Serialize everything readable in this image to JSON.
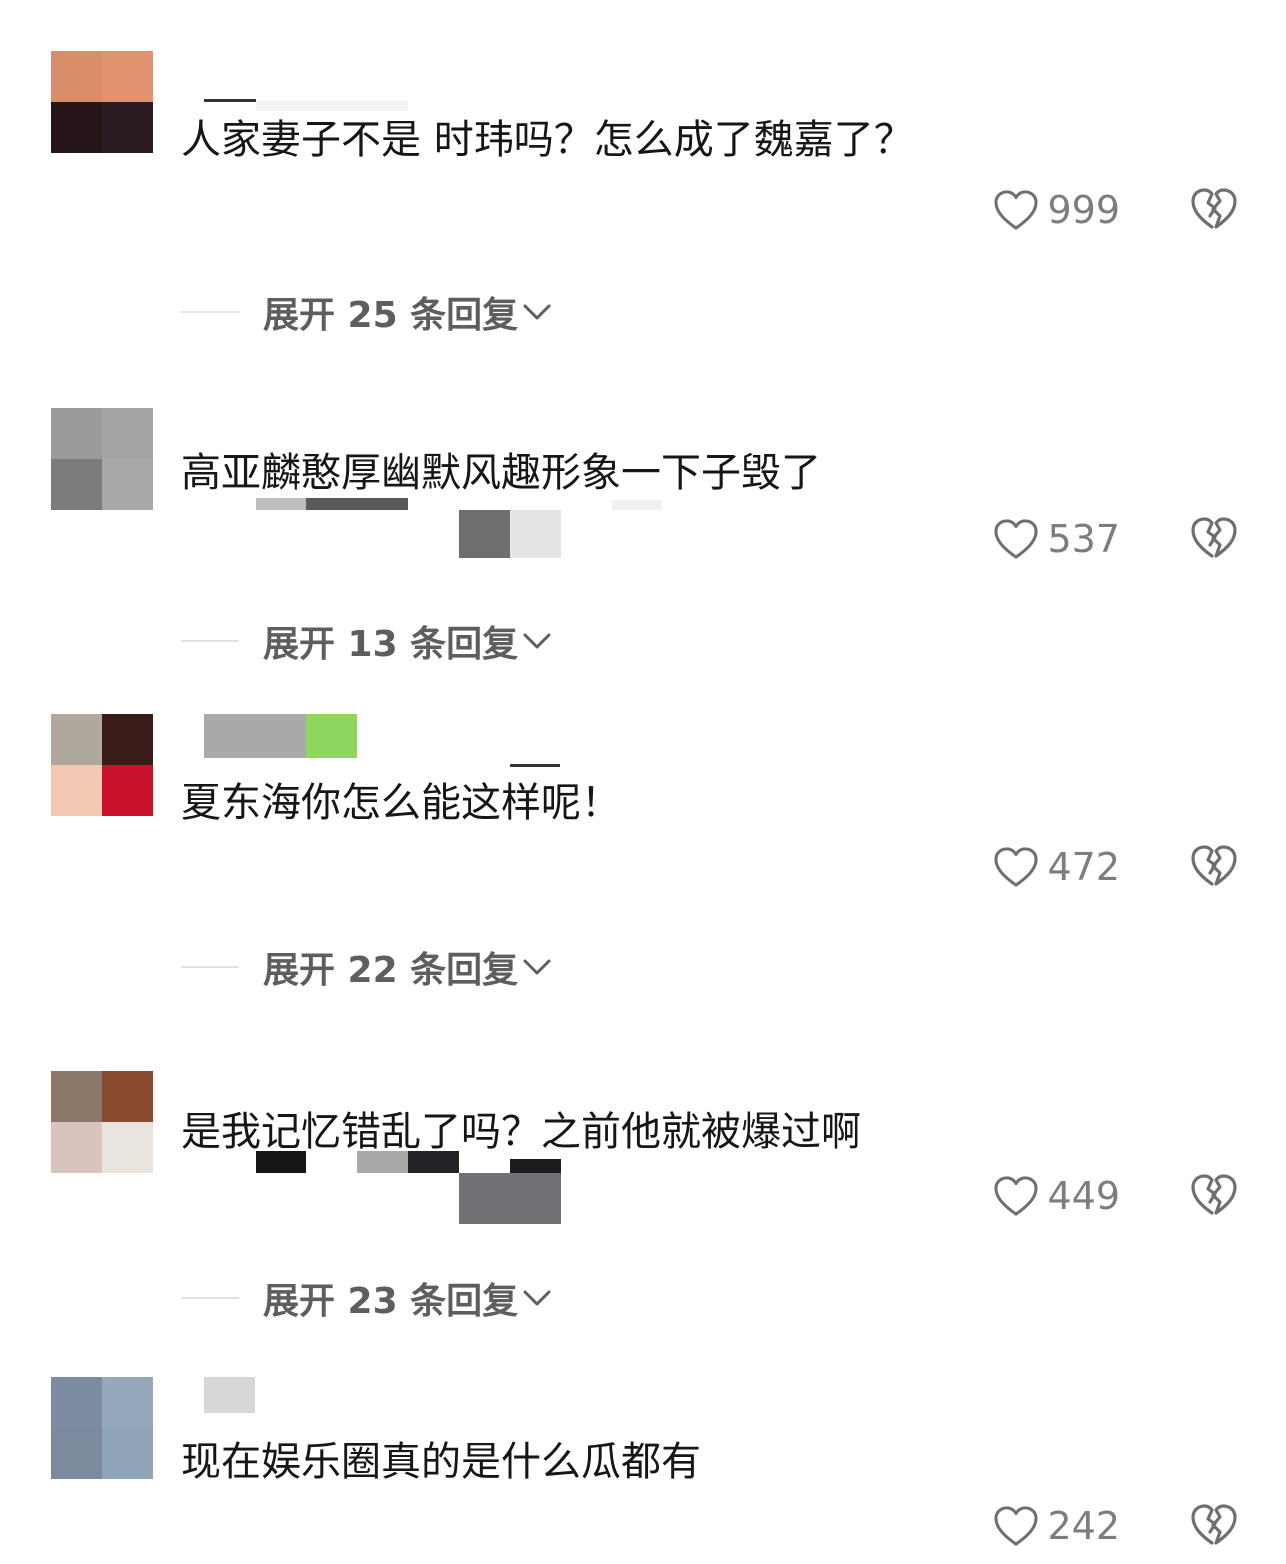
{
  "comments": [
    {
      "text": "人家妻子不是 时玮吗？怎么成了魏嘉了？",
      "likes": "999",
      "replies_label": "展开 25 条回复",
      "avatar_colors": [
        "#d98d68",
        "#e0936e",
        "#251418",
        "#2a1c22"
      ]
    },
    {
      "text": "高亚麟憨厚幽默风趣形象一下子毁了",
      "likes": "537",
      "replies_label": "展开 13 条回复",
      "avatar_colors": [
        "#9a9a9a",
        "#a4a4a4",
        "#7c7c7c",
        "#a8a8a8"
      ]
    },
    {
      "text": "夏东海你怎么能这样呢！",
      "likes": "472",
      "replies_label": "展开 22 条回复",
      "avatar_colors": [
        "#b0a79f",
        "#3a1c1a",
        "#f3c8b2",
        "#c8102a"
      ]
    },
    {
      "text": "是我记忆错乱了吗？之前他就被爆过啊",
      "likes": "449",
      "replies_label": "展开 23 条回复",
      "avatar_colors": [
        "#8c7868",
        "#8a4a30",
        "#d8c4bd",
        "#e9e4de"
      ]
    },
    {
      "text": "现在娱乐圈真的是什么瓜都有",
      "likes": "242",
      "replies_label": "",
      "avatar_colors": [
        "#7c8ca0",
        "#96a9bc",
        "#7b8b9e",
        "#90a4b8"
      ]
    }
  ]
}
